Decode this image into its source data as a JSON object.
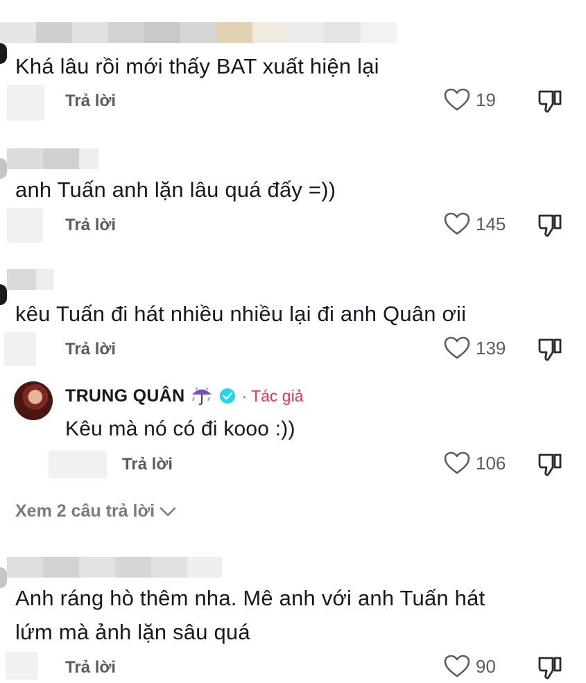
{
  "comments": [
    {
      "text": "Khá lâu rồi mới thấy BAT xuất hiện lại",
      "reply_label": "Trả lời",
      "likes": "19"
    },
    {
      "text": "anh Tuấn anh lặn lâu quá đấy =))",
      "reply_label": "Trả lời",
      "likes": "145"
    },
    {
      "text": "kêu Tuấn đi hát nhiều nhiều lại đi anh Quân ơii",
      "reply_label": "Trả lời",
      "likes": "139",
      "reply": {
        "author": "TRUNG QUÂN",
        "author_badge": "· Tác giả",
        "text": "Kêu mà nó có đi kooo :))",
        "reply_label": "Trả lời",
        "likes": "106"
      },
      "view_more": "Xem 2 câu trả lời"
    },
    {
      "text_line1": "Anh ráng hò thêm nha. Mê anh với anh Tuấn hát",
      "text_line2": "lứm mà ảnh lặn sâu quá",
      "reply_label": "Trả lời",
      "likes": "90"
    }
  ],
  "colors": {
    "heart_outline": "#5b5b63",
    "author_badge": "#fe2c55",
    "verified": "#20d5ec"
  },
  "icons": [
    "heart-icon",
    "dislike-icon",
    "verified-icon",
    "umbrella-rain-icon",
    "chevron-down-icon"
  ]
}
